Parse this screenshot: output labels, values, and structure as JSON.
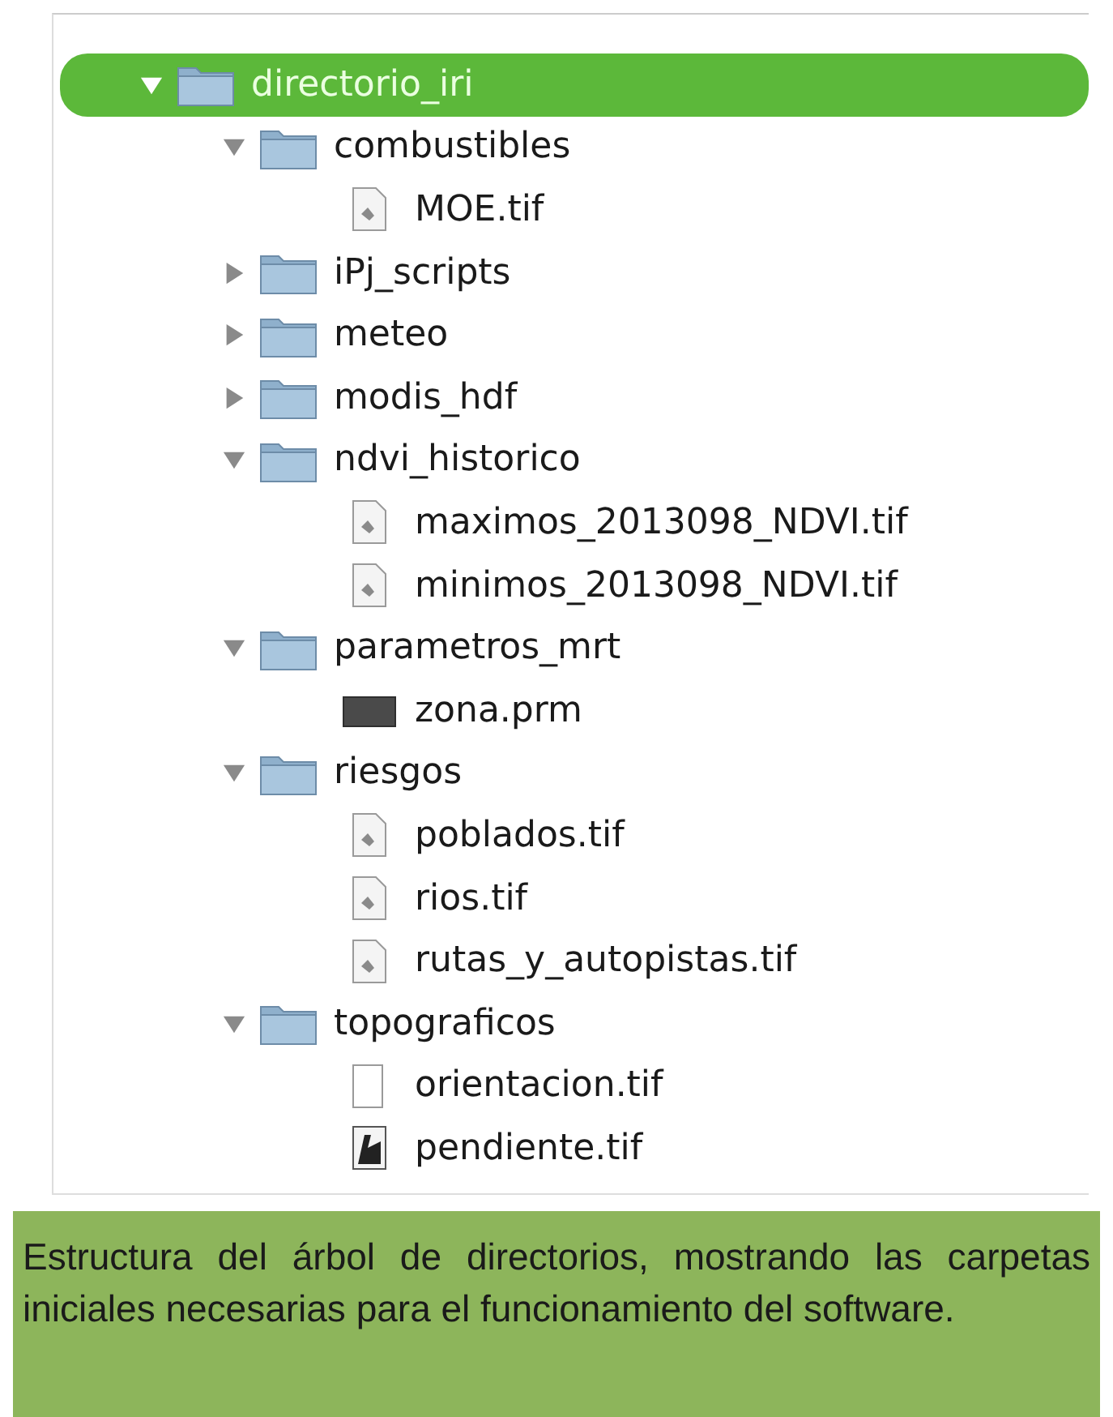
{
  "tree": {
    "items": [
      {
        "name": "directorio_iri",
        "kind": "folder",
        "expanded": true,
        "selected": true,
        "children": [
          {
            "name": "combustibles",
            "kind": "folder",
            "expanded": true,
            "selected": false,
            "children": [
              {
                "name": "MOE.tif",
                "kind": "image-file",
                "selected": false
              }
            ]
          },
          {
            "name": "iPj_scripts",
            "kind": "folder",
            "expanded": false,
            "selected": false
          },
          {
            "name": "meteo",
            "kind": "folder",
            "expanded": false,
            "selected": false
          },
          {
            "name": "modis_hdf",
            "kind": "folder",
            "expanded": false,
            "selected": false
          },
          {
            "name": "ndvi_historico",
            "kind": "folder",
            "expanded": true,
            "selected": false,
            "children": [
              {
                "name": "maximos_2013098_NDVI.tif",
                "kind": "image-file",
                "selected": false
              },
              {
                "name": "minimos_2013098_NDVI.tif",
                "kind": "image-file",
                "selected": false
              }
            ]
          },
          {
            "name": "parametros_mrt",
            "kind": "folder",
            "expanded": true,
            "selected": false,
            "children": [
              {
                "name": "zona.prm",
                "kind": "dark-file",
                "selected": false
              }
            ]
          },
          {
            "name": "riesgos",
            "kind": "folder",
            "expanded": true,
            "selected": false,
            "children": [
              {
                "name": "poblados.tif",
                "kind": "image-file",
                "selected": false
              },
              {
                "name": "rios.tif",
                "kind": "image-file",
                "selected": false
              },
              {
                "name": "rutas_y_autopistas.tif",
                "kind": "image-file",
                "selected": false
              }
            ]
          },
          {
            "name": "topograficos",
            "kind": "folder",
            "expanded": true,
            "selected": false,
            "children": [
              {
                "name": "orientacion.tif",
                "kind": "blank-file",
                "selected": false
              },
              {
                "name": "pendiente.tif",
                "kind": "preview-file",
                "selected": false
              }
            ]
          }
        ]
      }
    ]
  },
  "caption": "Estructura del árbol de directorios, mostrando las carpetas iniciales necesarias para el funcionamiento del software."
}
